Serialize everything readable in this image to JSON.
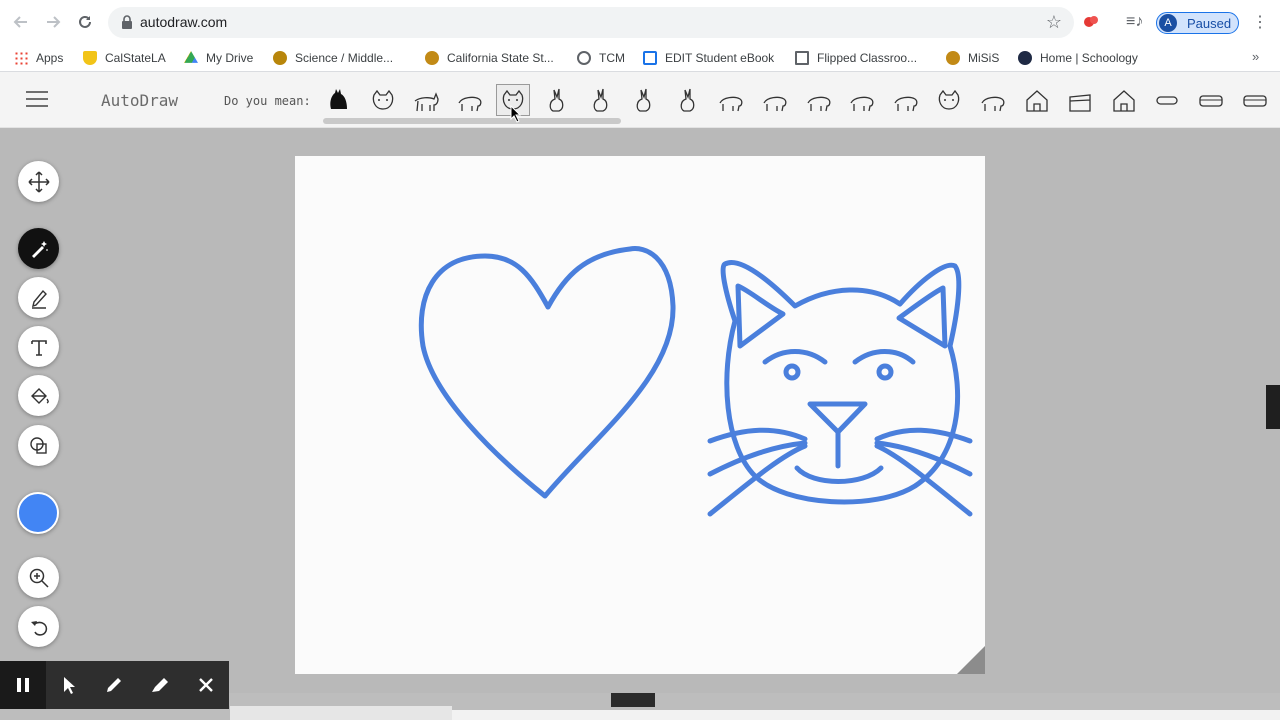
{
  "browser": {
    "url": "autodraw.com",
    "profile_initial": "A",
    "profile_status": "Paused",
    "bookmarks": [
      {
        "label": "Apps",
        "icon": "apps-grid-icon",
        "color": "#ea4335"
      },
      {
        "label": "CalStateLA",
        "icon": "shield-icon",
        "color": "#f2c418"
      },
      {
        "label": "My Drive",
        "icon": "google-drive-icon",
        "color": "#34a853"
      },
      {
        "label": "Science / Middle...",
        "icon": "site-favicon",
        "color": "#b8860b"
      },
      {
        "label": "California State St...",
        "icon": "site-favicon",
        "color": "#c28a16"
      },
      {
        "label": "TCM",
        "icon": "globe-icon",
        "color": "#5f6368"
      },
      {
        "label": "EDIT Student eBook",
        "icon": "ebook-icon",
        "color": "#1a73e8"
      },
      {
        "label": "Flipped Classroo...",
        "icon": "folder-icon",
        "color": "#5f6368"
      },
      {
        "label": "MiSiS",
        "icon": "site-favicon",
        "color": "#c28a16"
      },
      {
        "label": "Home | Schoology",
        "icon": "schoology-icon",
        "color": "#1f2a44"
      }
    ]
  },
  "app": {
    "title": "AutoDraw",
    "suggest_label": "Do you mean:",
    "suggestions": [
      "cat-silhouette",
      "cat-face",
      "cat-walking",
      "cat-side",
      "cat-face-selected",
      "cat-sitting",
      "rabbit-sitting",
      "rabbit",
      "rabbit-standing",
      "pig",
      "deer",
      "hippo",
      "cow",
      "horse",
      "cow-face",
      "elephant",
      "house",
      "building",
      "house-3d",
      "pill",
      "bus",
      "loaf",
      "more"
    ],
    "selected_suggestion": "cat-face-selected",
    "tools": [
      {
        "name": "move-tool-button",
        "icon": "move-arrows-icon",
        "active": false
      },
      {
        "name": "autodraw-tool-button",
        "icon": "magic-pen-icon",
        "active": true
      },
      {
        "name": "draw-tool-button",
        "icon": "pencil-icon",
        "active": false
      },
      {
        "name": "type-tool-button",
        "icon": "text-t-icon",
        "active": false
      },
      {
        "name": "fill-tool-button",
        "icon": "paint-bucket-icon",
        "active": false
      },
      {
        "name": "shape-tool-button",
        "icon": "shapes-icon",
        "active": false
      },
      {
        "name": "zoom-tool-button",
        "icon": "zoom-in-icon",
        "active": false
      },
      {
        "name": "undo-button",
        "icon": "undo-icon",
        "active": false
      }
    ],
    "current_color": "#4285f4",
    "stroke_color": "#4a7fdc"
  },
  "recorder": {
    "buttons": [
      "pause-icon",
      "pointer-icon",
      "pen-icon",
      "highlighter-icon",
      "close-icon"
    ]
  }
}
